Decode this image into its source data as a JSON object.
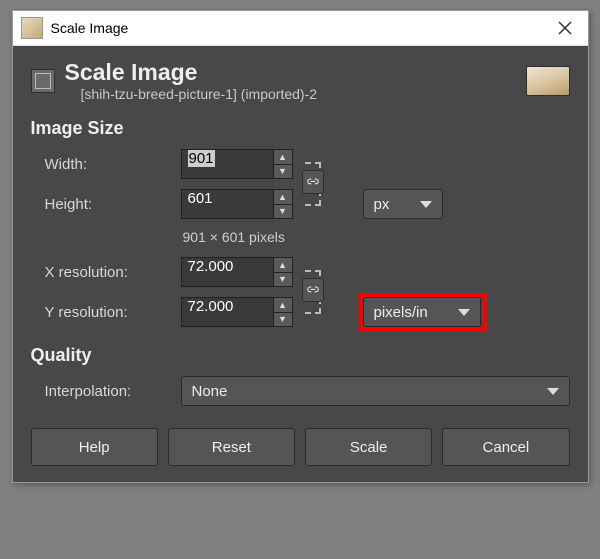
{
  "titlebar": {
    "title": "Scale Image"
  },
  "header": {
    "title": "Scale Image",
    "subtitle": "[shih-tzu-breed-picture-1] (imported)-2"
  },
  "size": {
    "section_label": "Image Size",
    "width_label": "Width:",
    "width_value": "901",
    "height_label": "Height:",
    "height_value": "601",
    "unit_label": "px",
    "dims_note": "901 × 601 pixels"
  },
  "resolution": {
    "x_label": "X resolution:",
    "x_value": "72.000",
    "y_label": "Y resolution:",
    "y_value": "72.000",
    "unit_label": "pixels/in"
  },
  "quality": {
    "section_label": "Quality",
    "interp_label": "Interpolation:",
    "interp_value": "None"
  },
  "buttons": {
    "help": "Help",
    "reset": "Reset",
    "scale": "Scale",
    "cancel": "Cancel"
  }
}
